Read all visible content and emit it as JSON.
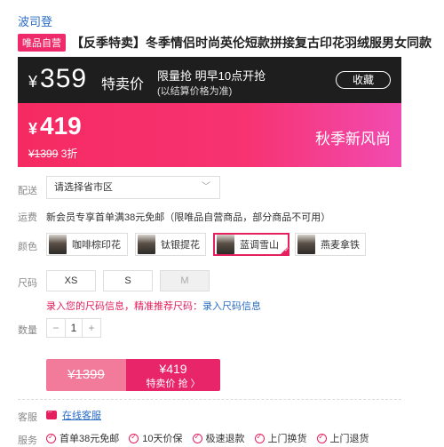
{
  "brand": "波司登",
  "badge": "唯品自营",
  "title": "【反季特卖】冬季情侣时尚英伦短款拼接复古印花羽绒服男女同款",
  "promo": {
    "currency": "¥",
    "price": "359",
    "tag": "特卖价",
    "info_line1": "限量抢 明早10点开抢",
    "info_line2": "(以结算价格为准)",
    "remind_btn": "收藏"
  },
  "current": {
    "currency": "¥",
    "price": "419",
    "original": "¥1399",
    "discount": "3折",
    "season_text": "秋季新风尚"
  },
  "labels": {
    "delivery": "配送",
    "shipping": "运费",
    "color": "颜色",
    "size": "尺码",
    "quantity": "数量",
    "service_chat": "客服",
    "services": "服务"
  },
  "delivery": {
    "placeholder": "请选择省市区",
    "arrow": "﹀"
  },
  "shipping_text": "新会员专享首单满38元免邮（限唯品自营商品，部分商品不可用）",
  "colors": [
    {
      "label": "咖啡棕印花"
    },
    {
      "label": "钛银提花"
    },
    {
      "label": "蓝调雪山",
      "selected": true
    },
    {
      "label": "燕麦拿铁"
    }
  ],
  "sizes": [
    {
      "label": "XS"
    },
    {
      "label": "S"
    },
    {
      "label": "M",
      "disabled": true
    }
  ],
  "size_hint": {
    "text": "录入您的尺码信息，精准推荐尺码：",
    "link": "录入尺码信息"
  },
  "quantity": {
    "minus": "−",
    "value": "1",
    "plus": "+"
  },
  "buy": {
    "orig_price": "¥1399",
    "price": "¥419",
    "action": "特卖价 抢 〉"
  },
  "chat_link": "在线客服",
  "services": [
    "首单38元免邮",
    "10天价保",
    "极速退款",
    "上门换货",
    "上门退货"
  ]
}
